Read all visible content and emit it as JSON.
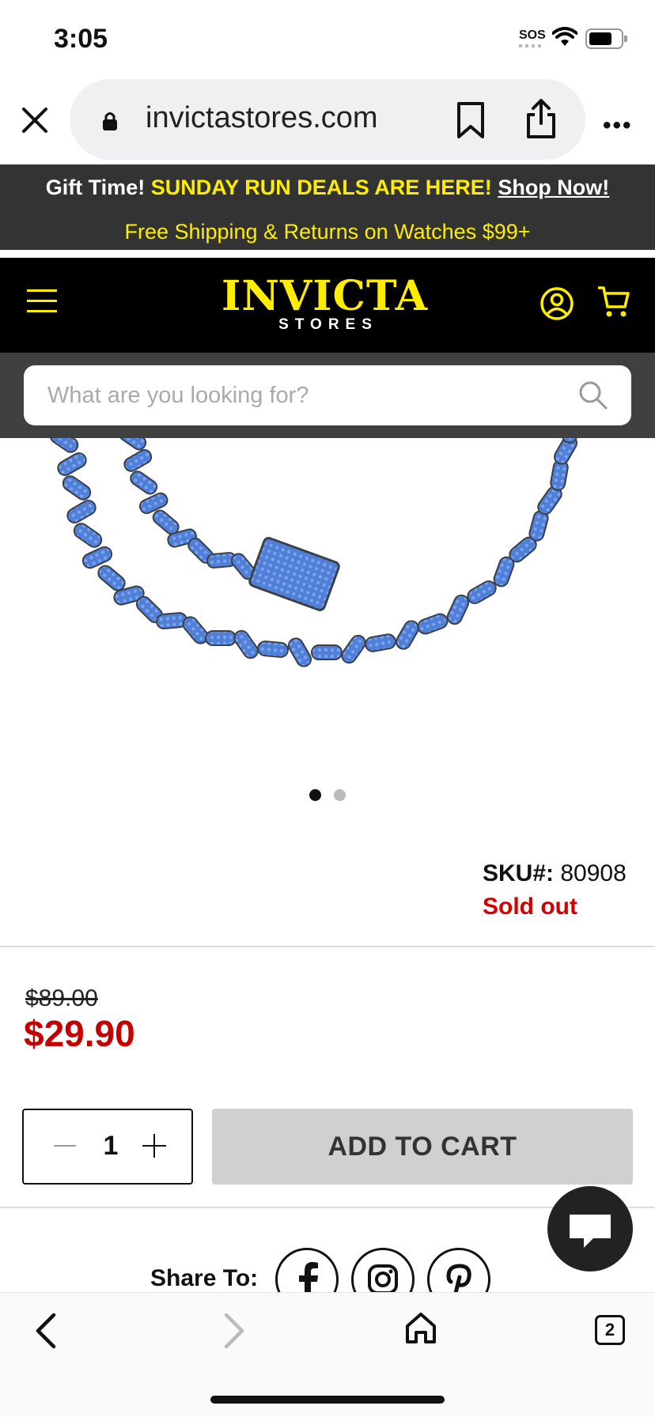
{
  "status": {
    "time": "3:05",
    "sos": "SOS"
  },
  "browser": {
    "url": "invictastores.com",
    "tab_count": "2"
  },
  "promo": {
    "gift": "Gift Time!",
    "deals": "SUNDAY RUN DEALS ARE HERE!",
    "shop": "Shop Now!",
    "shipping": "Free Shipping & Returns on Watches $99+"
  },
  "header": {
    "logo_main": "INVICTA",
    "logo_sub": "STORES"
  },
  "search": {
    "placeholder": "What are you looking for?"
  },
  "product": {
    "sku_label": "SKU#:",
    "sku": "80908",
    "availability": "Sold out",
    "old_price": "$89.00",
    "price": "$29.90",
    "quantity": "1",
    "add_to_cart": "ADD TO CART",
    "image_count": 2,
    "active_image": 1
  },
  "share": {
    "label": "Share To:"
  },
  "colors": {
    "brand_yellow": "#ffed00",
    "price_red": "#c40000",
    "chain_blue": "#4f7fd6"
  },
  "icons": [
    "close-icon",
    "lock-icon",
    "bookmark-icon",
    "share-icon",
    "more-icon",
    "menu-icon",
    "account-icon",
    "cart-icon",
    "search-icon",
    "facebook-icon",
    "instagram-icon",
    "pinterest-icon",
    "chat-icon",
    "back-icon",
    "forward-icon",
    "home-icon",
    "tabs-icon"
  ]
}
